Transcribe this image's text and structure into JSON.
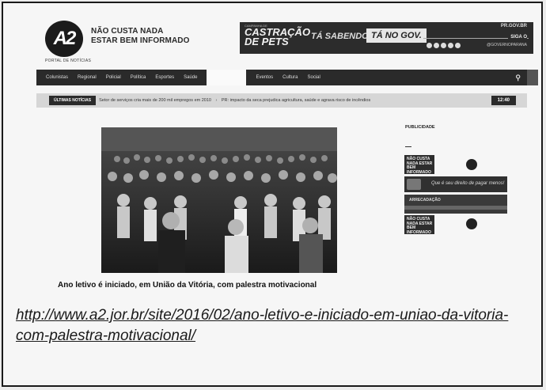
{
  "header": {
    "logo_text": "A2",
    "logo_subtitle": "PORTAL DE NOTÍCIAS",
    "slogan_line1": "NÃO CUSTA NADA",
    "slogan_line2": "ESTAR BEM INFORMADO"
  },
  "banner": {
    "small": "CAMPANHA DE",
    "main_line1": "CASTRAÇÃO",
    "main_line2": "DE PETS",
    "sabendo": "TÁ SABENDO?",
    "gov": "TÁ NO GOV.",
    "pr": "PR.GOV.BR",
    "siga": "SIGA O",
    "handle": "@GOVERNOPARANA"
  },
  "nav": {
    "items": [
      "Colunistas",
      "Regional",
      "Policial",
      "Política",
      "Esportes",
      "Saúde"
    ],
    "items_right": [
      "Eventos",
      "Cultura",
      "Social"
    ],
    "search_icon": "search-icon"
  },
  "ticker": {
    "label": "ÚLTIMAS NOTÍCIAS",
    "item1": "Setor de serviços cria mais de 200 mil empregos em 2010",
    "item2": "PR: impacto da seca prejudica agricultura, saúde e agrava risco de incêndios",
    "time": "12:40"
  },
  "article": {
    "headline": "Ano letivo é iniciado, em União da Vitória, com palestra motivacional"
  },
  "sidebar": {
    "publicidade": "PUBLICIDADE",
    "ad1_text": "NÃO CUSTA NADA ESTAR BEM INFORMADO",
    "ad2_text": "Que é seu direito de pagar menos!",
    "ad3_text": "ARRECADAÇÃO",
    "ad4_text": "NÃO CUSTA NADA ESTAR BEM INFORMADO"
  },
  "url": "http://www.a2.jor.br/site/2016/02/ano-letivo-e-iniciado-em-uniao-da-vitoria-com-palestra-motivacional/"
}
